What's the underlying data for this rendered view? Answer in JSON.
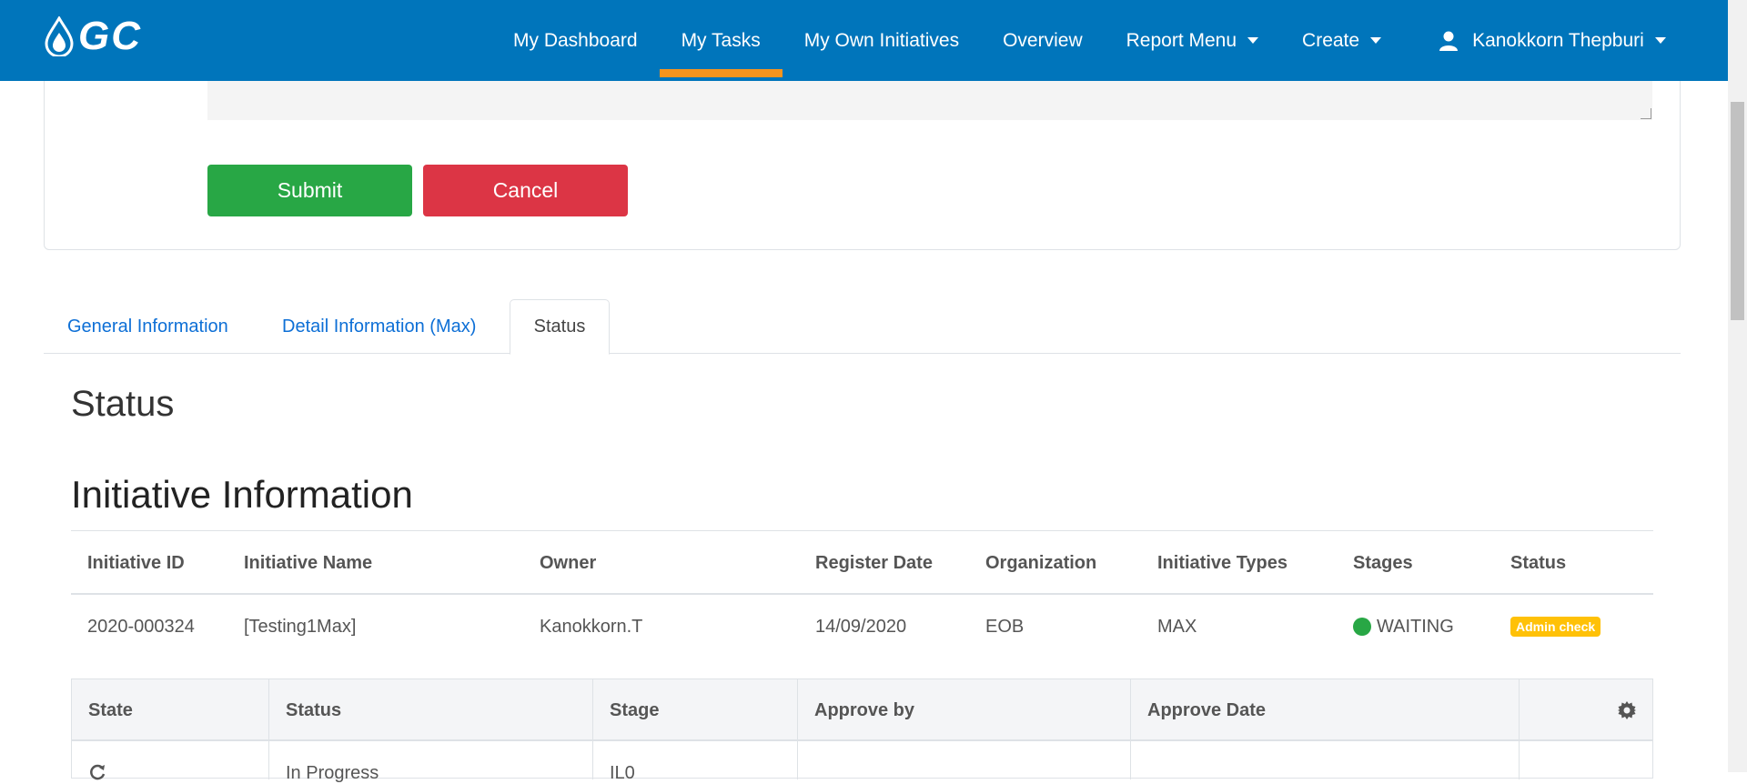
{
  "brand": {
    "logo_text": "GC"
  },
  "nav": {
    "items": [
      {
        "label": "My Dashboard",
        "active": false,
        "dropdown": false
      },
      {
        "label": "My Tasks",
        "active": true,
        "dropdown": false
      },
      {
        "label": "My Own Initiatives",
        "active": false,
        "dropdown": false
      },
      {
        "label": "Overview",
        "active": false,
        "dropdown": false
      },
      {
        "label": "Report Menu",
        "active": false,
        "dropdown": true
      },
      {
        "label": "Create",
        "active": false,
        "dropdown": true
      }
    ],
    "user": "Kanokkorn Thepburi"
  },
  "form": {
    "submit_label": "Submit",
    "cancel_label": "Cancel"
  },
  "tabs": [
    {
      "label": "General Information"
    },
    {
      "label": "Detail Information (Max)"
    },
    {
      "label": "Status"
    }
  ],
  "status_heading": "Status",
  "initiative_heading": "Initiative Information",
  "initiative_table": {
    "headers": [
      "Initiative ID",
      "Initiative Name",
      "Owner",
      "Register Date",
      "Organization",
      "Initiative Types",
      "Stages",
      "Status"
    ],
    "row": {
      "id": "2020-000324",
      "name": "[Testing1Max]",
      "owner": "Kanokkorn.T",
      "register_date": "14/09/2020",
      "organization": "EOB",
      "type": "MAX",
      "stage": "WAITING",
      "status_badge": "Admin check"
    }
  },
  "state_table": {
    "headers": [
      "State",
      "Status",
      "Stage",
      "Approve by",
      "Approve Date"
    ],
    "row": {
      "status": "In Progress",
      "stage": "IL0"
    }
  },
  "colors": {
    "navbar": "#0075bb",
    "active_underline": "#f7941d",
    "submit": "#28a745",
    "cancel": "#dc3545",
    "badge": "#ffc107"
  }
}
